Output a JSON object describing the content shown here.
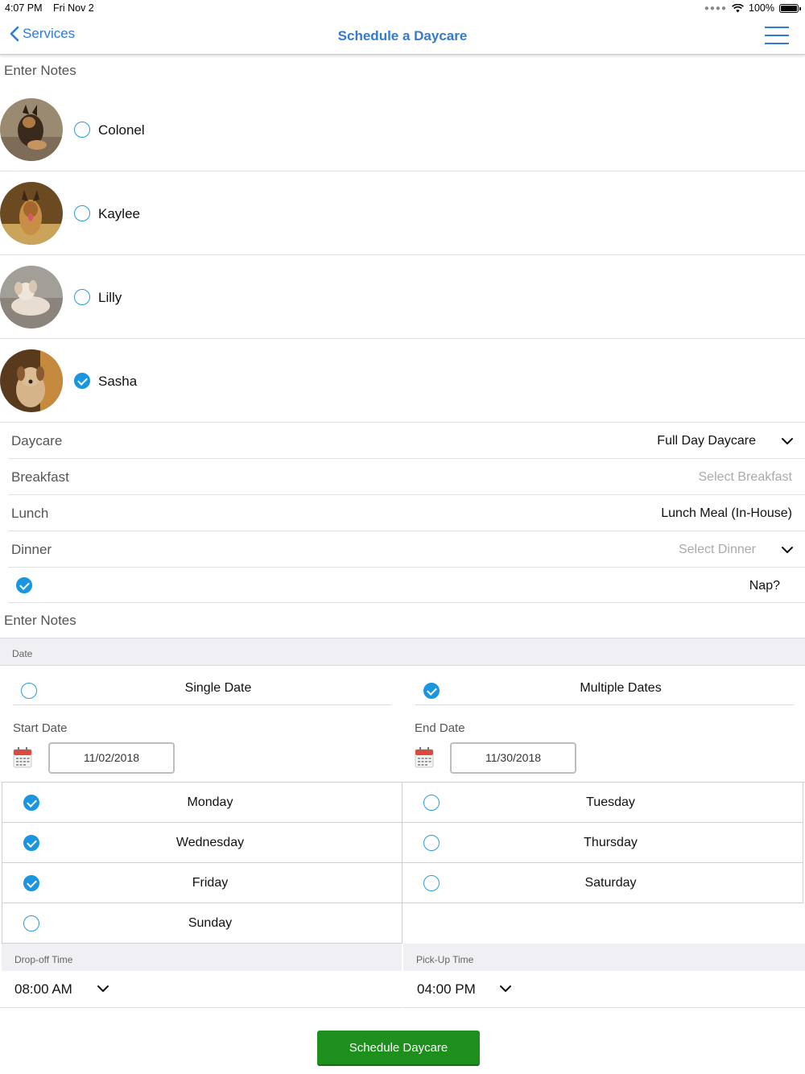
{
  "status_bar": {
    "time": "4:07 PM",
    "date": "Fri Nov 2",
    "battery": "100%",
    "battery_level": 1.0
  },
  "nav": {
    "back_label": "Services",
    "title": "Schedule a Daycare"
  },
  "notes_label_top": "Enter Notes",
  "pets": [
    {
      "name": "Colonel",
      "selected": false
    },
    {
      "name": "Kaylee",
      "selected": false
    },
    {
      "name": "Lilly",
      "selected": false
    },
    {
      "name": "Sasha",
      "selected": true
    }
  ],
  "services": {
    "daycare": {
      "label": "Daycare",
      "value": "Full Day Daycare"
    },
    "breakfast": {
      "label": "Breakfast",
      "placeholder": "Select Breakfast"
    },
    "lunch": {
      "label": "Lunch",
      "value": "Lunch Meal (In-House)"
    },
    "dinner": {
      "label": "Dinner",
      "placeholder": "Select Dinner"
    },
    "nap": {
      "label": "Nap?",
      "checked": true
    }
  },
  "notes_label_bottom": "Enter Notes",
  "date_section": {
    "header": "Date",
    "single_label": "Single Date",
    "multiple_label": "Multiple Dates",
    "single_selected": false,
    "multiple_selected": true,
    "start_label": "Start Date",
    "start_value": "11/02/2018",
    "end_label": "End Date",
    "end_value": "11/30/2018"
  },
  "days": [
    {
      "name": "Monday",
      "checked": true
    },
    {
      "name": "Tuesday",
      "checked": false
    },
    {
      "name": "Wednesday",
      "checked": true
    },
    {
      "name": "Thursday",
      "checked": false
    },
    {
      "name": "Friday",
      "checked": true
    },
    {
      "name": "Saturday",
      "checked": false
    },
    {
      "name": "Sunday",
      "checked": false
    }
  ],
  "times": {
    "dropoff_label": "Drop-off Time",
    "dropoff_value": "08:00 AM",
    "pickup_label": "Pick-Up Time",
    "pickup_value": "04:00 PM"
  },
  "submit_label": "Schedule Daycare",
  "colors": {
    "accent": "#2f7bd6",
    "check": "#1a96e0",
    "button": "#1c8f1c"
  }
}
